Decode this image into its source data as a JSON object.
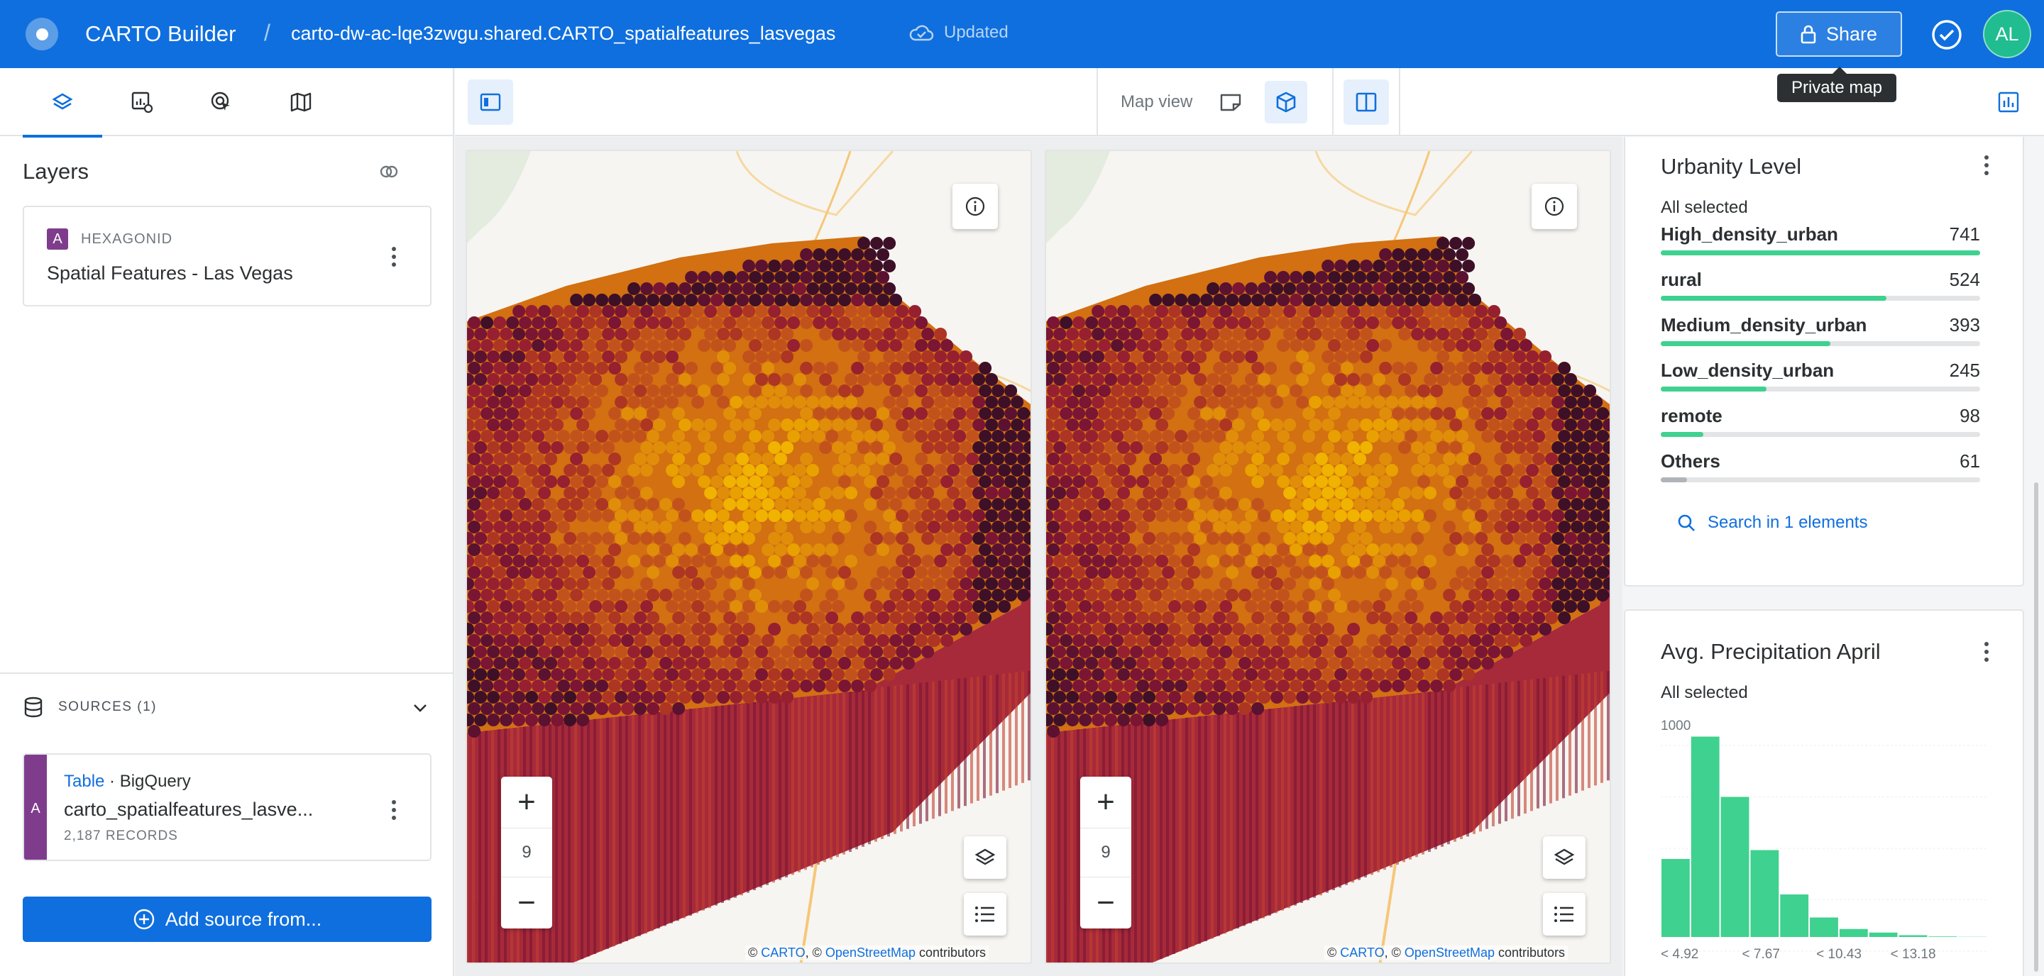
{
  "header": {
    "app_title": "CARTO Builder",
    "separator": "/",
    "map_name": "carto-dw-ac-lqe3zwgu.shared.CARTO_spatialfeatures_lasvegas",
    "save_status": "Updated",
    "share_label": "Share",
    "share_tooltip": "Private map",
    "avatar_initials": "AL",
    "brand_color": "#0f6fde"
  },
  "left_panel": {
    "tabs": [
      {
        "icon": "layers-icon",
        "active": true
      },
      {
        "icon": "widgets-settings-icon",
        "active": false
      },
      {
        "icon": "interactions-icon",
        "active": false
      },
      {
        "icon": "basemap-icon",
        "active": false
      }
    ],
    "layers_title": "Layers",
    "layers": [
      {
        "badge": "A",
        "type": "HEXAGONID",
        "name": "Spatial Features - Las Vegas",
        "badge_color": "#7f3c8d"
      }
    ],
    "sources_label": "SOURCES (1)",
    "sources": [
      {
        "badge": "A",
        "kind_link": "Table",
        "kind_sep": "·",
        "provider": "BigQuery",
        "table": "carto_spatialfeatures_lasve...",
        "records": "2,187 RECORDS"
      }
    ],
    "add_source_label": "Add source from..."
  },
  "map_toolbar": {
    "map_view_label": "Map view",
    "view_modes": [
      "2d-view-icon",
      "3d-view-icon"
    ],
    "active_mode": "3d-view-icon",
    "split_view": true
  },
  "maps": [
    {
      "zoom": "9",
      "attribution": {
        "prefix": "©",
        "carto": "CARTO",
        "sep": ", ©",
        "osm": "OpenStreetMap",
        "suffix": "contributors"
      }
    },
    {
      "zoom": "9",
      "attribution": {
        "prefix": "©",
        "carto": "CARTO",
        "sep": ", ©",
        "osm": "OpenStreetMap",
        "suffix": "contributors"
      }
    }
  ],
  "widgets": {
    "urbanity": {
      "title": "Urbanity Level",
      "subtitle": "All selected",
      "max": 741,
      "categories": [
        {
          "name": "High_density_urban",
          "value": 741,
          "display": "741"
        },
        {
          "name": "rural",
          "value": 524,
          "display": "524"
        },
        {
          "name": "Medium_density_urban",
          "value": 393,
          "display": "393"
        },
        {
          "name": "Low_density_urban",
          "value": 245,
          "display": "245"
        },
        {
          "name": "remote",
          "value": 98,
          "display": "98"
        },
        {
          "name": "Others",
          "value": 61,
          "display": "61"
        }
      ],
      "search_label": "Search in 1 elements",
      "bar_color": "#3fd18f"
    },
    "precipitation": {
      "title": "Avg. Precipitation April",
      "subtitle": "All selected"
    }
  },
  "chart_data": {
    "type": "bar",
    "title": "Avg. Precipitation April",
    "y_tick_label": "1000",
    "ylim": [
      0,
      1000
    ],
    "values": [
      440,
      1130,
      790,
      490,
      240,
      110,
      45,
      25,
      10,
      3,
      1
    ],
    "x_tick_labels": [
      "< 4.92",
      "< 7.67",
      "< 10.43",
      "< 13.18"
    ],
    "color": "#3fd18f"
  }
}
